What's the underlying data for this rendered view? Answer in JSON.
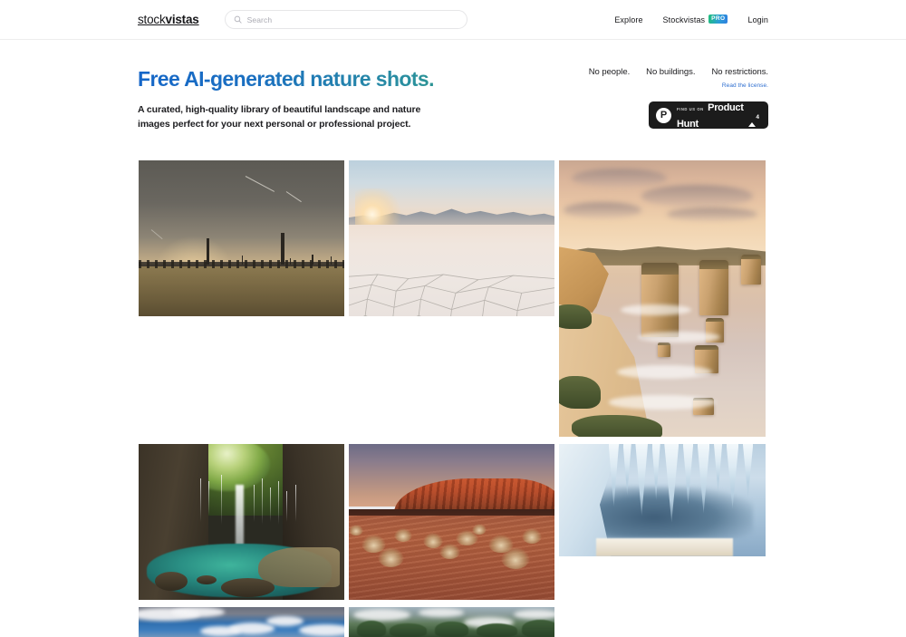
{
  "header": {
    "logo_light": "stock",
    "logo_bold": "vistas",
    "search": {
      "placeholder": "Search",
      "value": "",
      "icon": "search-icon"
    },
    "nav": [
      {
        "label": "Explore",
        "badge": null
      },
      {
        "label": "Stockvistas",
        "badge": "PRO"
      },
      {
        "label": "Login",
        "badge": null
      }
    ]
  },
  "hero": {
    "headline": "Free AI-generated nature shots.",
    "subheadline": "A curated, high-quality library of beautiful landscape and nature images perfect for your next personal or professional project.",
    "claims": [
      "No people.",
      "No buildings.",
      "No restrictions."
    ],
    "license_link": "Read the license.",
    "product_hunt": {
      "kicker": "FIND US ON",
      "name": "Product Hunt",
      "upvotes": "4",
      "logo_letter": "P"
    }
  },
  "gallery": {
    "tiles": [
      {
        "name": "savanna-acacia-dusk",
        "alt": "Savanna grassland with acacia trees at dusk"
      },
      {
        "name": "salt-flat-sunrise",
        "alt": "Cracked salt flat with mountains at sunrise"
      },
      {
        "name": "coastal-rock-stacks-sunset",
        "alt": "Coastal limestone rock stacks at sunset"
      },
      {
        "name": "cave-waterfall-pool",
        "alt": "Cave waterfall falling into a turquoise pool"
      },
      {
        "name": "red-desert-monolith",
        "alt": "Red sandstone monolith over desert dunes"
      },
      {
        "name": "ice-cave-icicles",
        "alt": "Blue ice cave with hanging icicles"
      },
      {
        "name": "cloudy-blue-sky",
        "alt": "Blue sky with scattered clouds"
      },
      {
        "name": "forest-ridge-clouds",
        "alt": "Green forested ridge under low clouds"
      }
    ]
  },
  "colors": {
    "headline_gradient_start": "#1667c8",
    "headline_gradient_end": "#35ab63",
    "link_blue": "#2f6fd0",
    "pro_badge_start": "#1fbf7a",
    "pro_badge_end": "#2f7fe0",
    "badge_background": "#1c1c1c",
    "text_primary": "#17171a",
    "border": "#ededed"
  }
}
